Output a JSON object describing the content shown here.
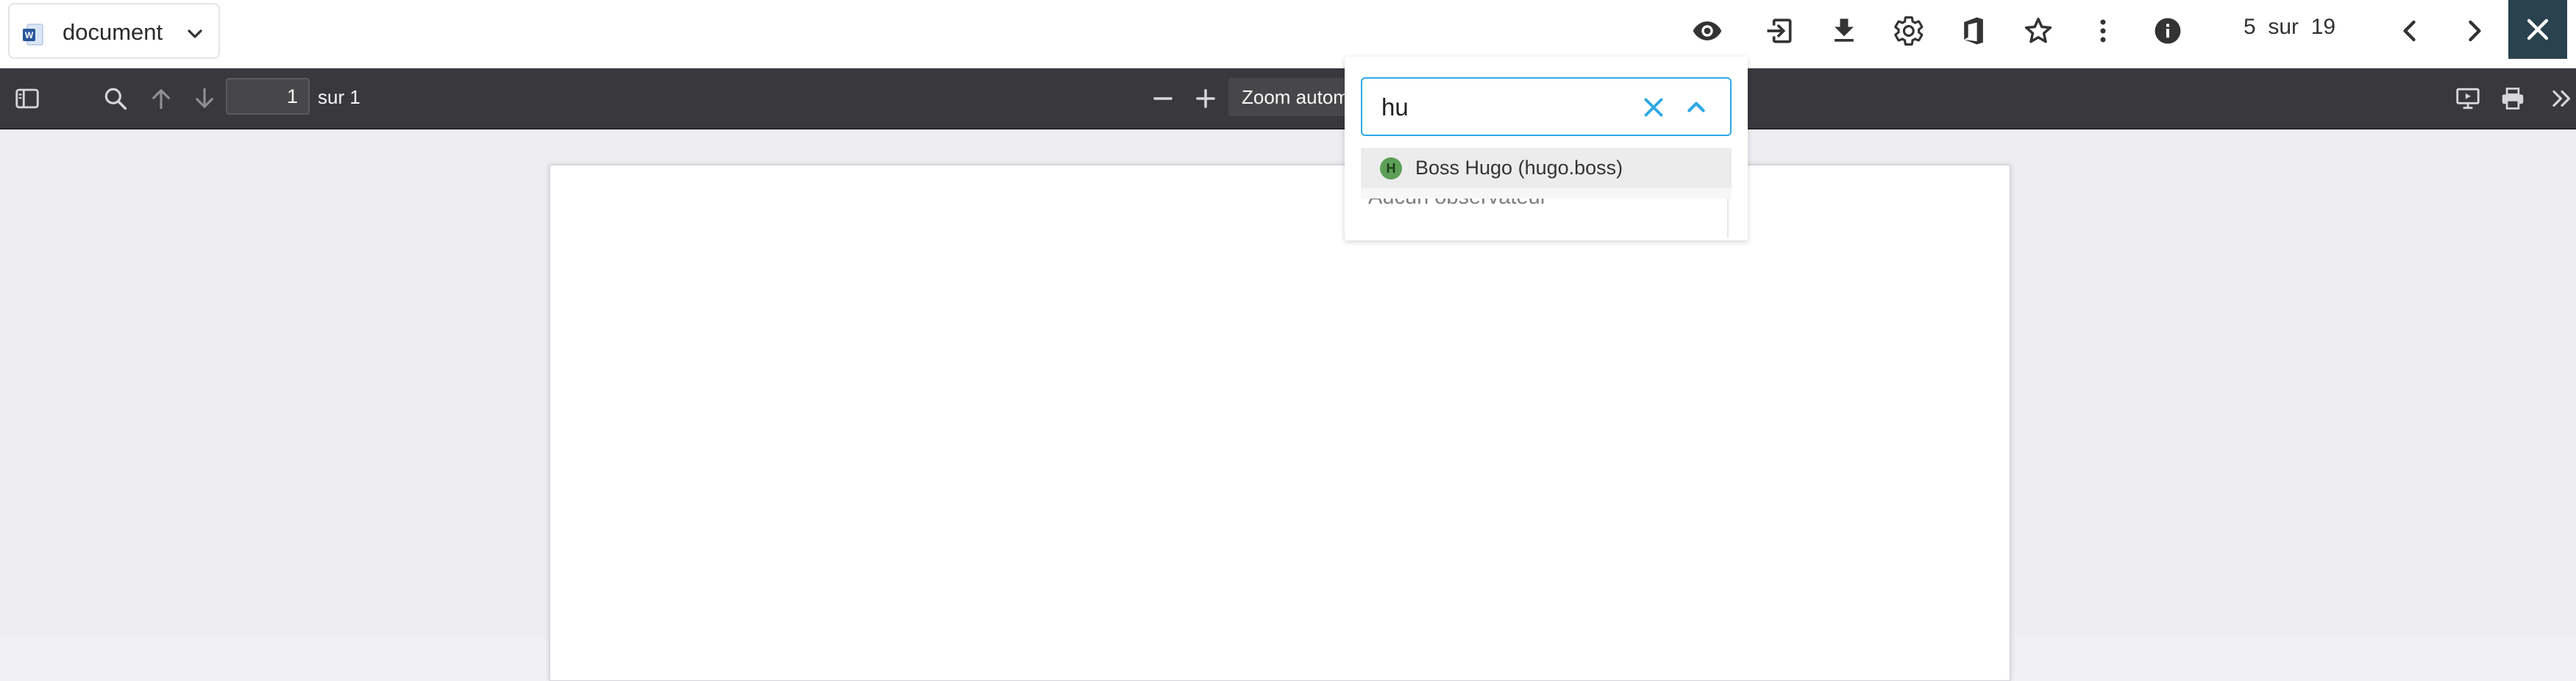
{
  "header": {
    "document_name": "document",
    "pager": {
      "current": "5",
      "separator": "sur",
      "total": "19"
    },
    "icons": [
      "eye-icon",
      "exit-to-app-icon",
      "download-icon",
      "settings-icon",
      "office-icon",
      "star-icon",
      "more-vert-icon",
      "info-icon",
      "chevron-left-icon",
      "chevron-right-icon",
      "close-icon"
    ],
    "colors": {
      "close_button_bg": "#29424d"
    }
  },
  "pdf_toolbar": {
    "page_number_value": "1",
    "page_count_label": "sur 1",
    "zoom_value": "Zoom automatique",
    "icons": [
      "sidebar-toggle-icon",
      "search-icon",
      "previous-page-icon",
      "next-page-icon",
      "zoom-out-icon",
      "zoom-in-icon",
      "presentation-mode-icon",
      "print-icon",
      "more-tools-icon"
    ],
    "colors": {
      "background": "#38383d"
    }
  },
  "observers": {
    "search_value": "hu",
    "empty_label": "Aucun observateur",
    "option": {
      "avatar_initial": "H",
      "label": "Boss Hugo (hugo.boss)"
    },
    "colors": {
      "focus_border": "#2ea8e6",
      "avatar_bg": "#5d9f57"
    }
  }
}
